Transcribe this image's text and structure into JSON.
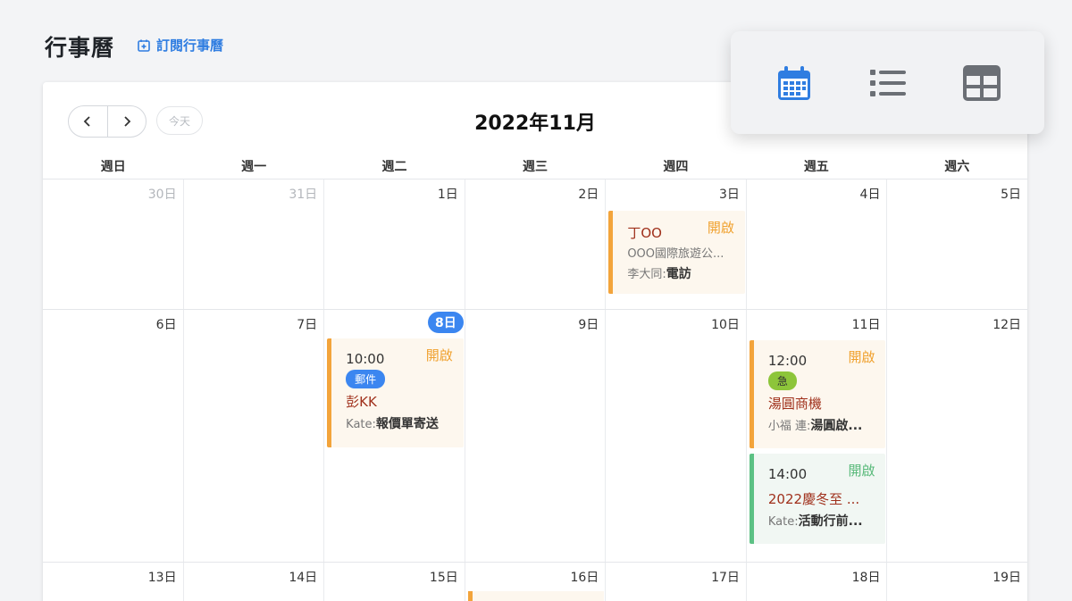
{
  "header": {
    "title": "行事曆",
    "subscribe_label": "訂閱行事曆"
  },
  "toolbar": {
    "today_label": "今天",
    "month_title": "2022年11月"
  },
  "weekdays": [
    "週日",
    "週一",
    "週二",
    "週三",
    "週四",
    "週五",
    "週六"
  ],
  "weeks": [
    {
      "days": [
        "30日",
        "31日",
        "1日",
        "2日",
        "3日",
        "4日",
        "5日"
      ]
    },
    {
      "days": [
        "6日",
        "7日",
        "8日",
        "9日",
        "10日",
        "11日",
        "12日"
      ]
    },
    {
      "days": [
        "13日",
        "14日",
        "15日",
        "16日",
        "17日",
        "18日",
        "19日"
      ]
    }
  ],
  "events": {
    "nov3": {
      "status": "開啟",
      "name": "丁OO",
      "company": "OOO國際旅遊公...",
      "person": "李大同:",
      "action": "電訪"
    },
    "nov8": {
      "status": "開啟",
      "time": "10:00",
      "tag": "郵件",
      "name": "彭KK",
      "person": "Kate:",
      "action": "報價單寄送"
    },
    "nov11a": {
      "status": "開啟",
      "time": "12:00",
      "tag": "急",
      "name": "湯圓商機",
      "person": "小福 連:",
      "action": "湯圓啟..."
    },
    "nov11b": {
      "status": "開啟",
      "time": "14:00",
      "name": "2022慶冬至 ...",
      "person": "Kate:",
      "action": "活動行前..."
    }
  },
  "colors": {
    "accent": "#3b86f0",
    "open_orange": "#f0a12e",
    "open_green": "#58b979",
    "event_name": "#a0311c"
  },
  "view_switch": {
    "icons": [
      "calendar-icon",
      "list-icon",
      "grid-icon"
    ],
    "active": "calendar-icon"
  }
}
